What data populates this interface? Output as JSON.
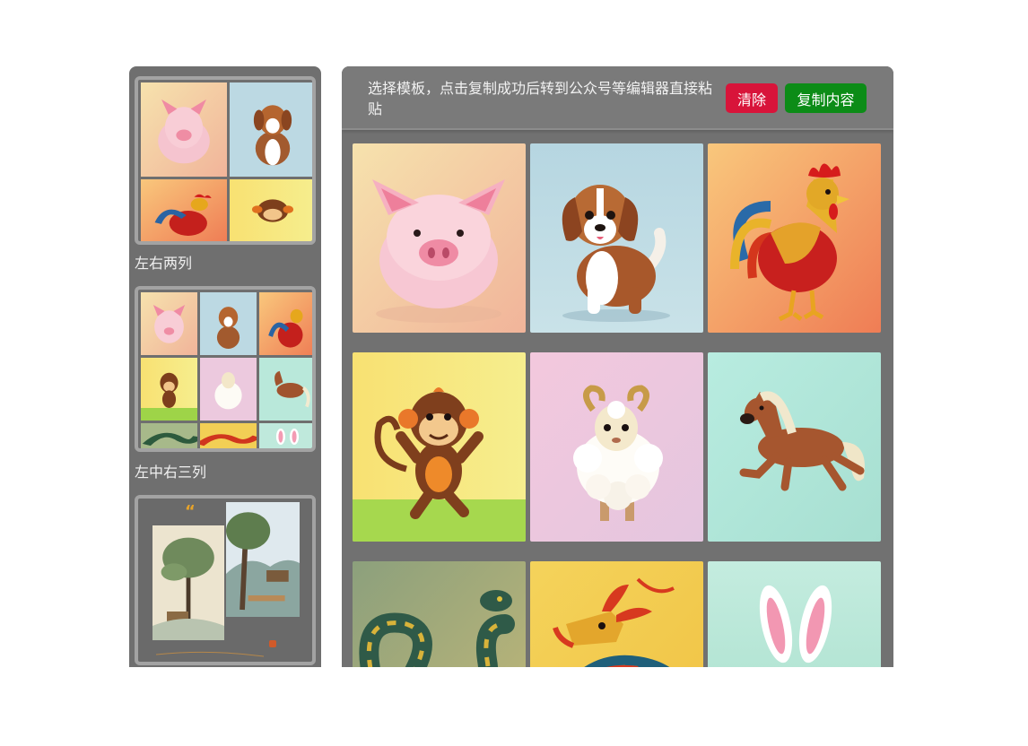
{
  "sidebar": {
    "templates": [
      {
        "label": "左右两列",
        "layout": "two-column"
      },
      {
        "label": "左中右三列",
        "layout": "three-column"
      },
      {
        "label": "",
        "layout": "quote-landscape"
      }
    ]
  },
  "toolbar": {
    "instructions": "选择模板，点击复制成功后转到公众号等编辑器直接粘贴",
    "clear_label": "清除",
    "copy_label": "复制内容"
  },
  "colors": {
    "clear_button": "#d8143a",
    "copy_button": "#0c8c17",
    "panel_bg": "#717171",
    "card_border": "#a3a3a3"
  },
  "gallery": {
    "images": [
      {
        "name": "pig",
        "icon": "felt-pig-image"
      },
      {
        "name": "dog",
        "icon": "felt-dog-image"
      },
      {
        "name": "rooster",
        "icon": "felt-rooster-image"
      },
      {
        "name": "monkey",
        "icon": "felt-monkey-image"
      },
      {
        "name": "sheep",
        "icon": "felt-sheep-image"
      },
      {
        "name": "horse",
        "icon": "felt-horse-image"
      },
      {
        "name": "snake",
        "icon": "felt-snake-image"
      },
      {
        "name": "dragon",
        "icon": "felt-dragon-image"
      },
      {
        "name": "rabbit",
        "icon": "felt-rabbit-image"
      }
    ]
  }
}
